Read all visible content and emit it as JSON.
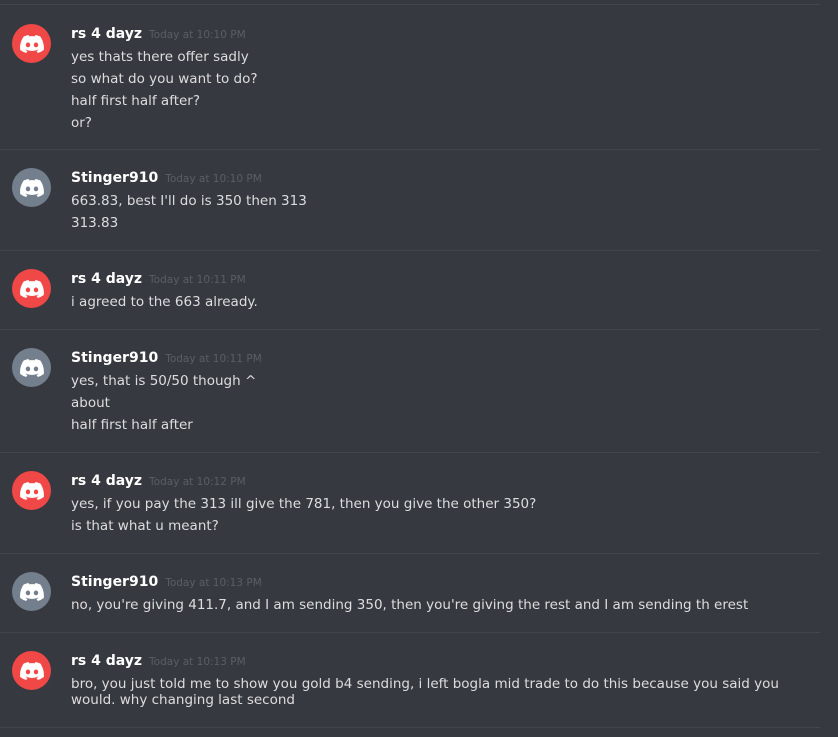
{
  "groups": [
    {
      "author": "rs 4 dayz",
      "timestamp": "Today at 10:10 PM",
      "avatar_color": "#f04747",
      "messages": [
        "yes thats there offer sadly",
        "so what do you want to do?",
        "half first half after?",
        "or?"
      ]
    },
    {
      "author": "Stinger910",
      "timestamp": "Today at 10:10 PM",
      "avatar_color": "#747f8d",
      "messages": [
        "663.83, best I'll do is 350 then 313",
        "313.83"
      ]
    },
    {
      "author": "rs 4 dayz",
      "timestamp": "Today at 10:11 PM",
      "avatar_color": "#f04747",
      "messages": [
        "i agreed to the 663 already."
      ]
    },
    {
      "author": "Stinger910",
      "timestamp": "Today at 10:11 PM",
      "avatar_color": "#747f8d",
      "messages": [
        "yes, that is 50/50 though ^",
        "about",
        "half first half after"
      ]
    },
    {
      "author": "rs 4 dayz",
      "timestamp": "Today at 10:12 PM",
      "avatar_color": "#f04747",
      "messages": [
        "yes, if you pay the 313 ill give the 781, then you give the other 350?",
        "is that what u meant?"
      ]
    },
    {
      "author": "Stinger910",
      "timestamp": "Today at 10:13 PM",
      "avatar_color": "#747f8d",
      "messages": [
        "no, you're giving 411.7, and I am sending 350, then you're giving the rest and I am sending th erest"
      ]
    },
    {
      "author": "rs 4 dayz",
      "timestamp": "Today at 10:13 PM",
      "avatar_color": "#f04747",
      "messages": [
        "bro, you just told me to show you gold b4 sending, i left bogla mid trade to do this because you said you would. why changing last second"
      ]
    }
  ],
  "icons": {
    "avatar": "discord-logo-icon"
  }
}
